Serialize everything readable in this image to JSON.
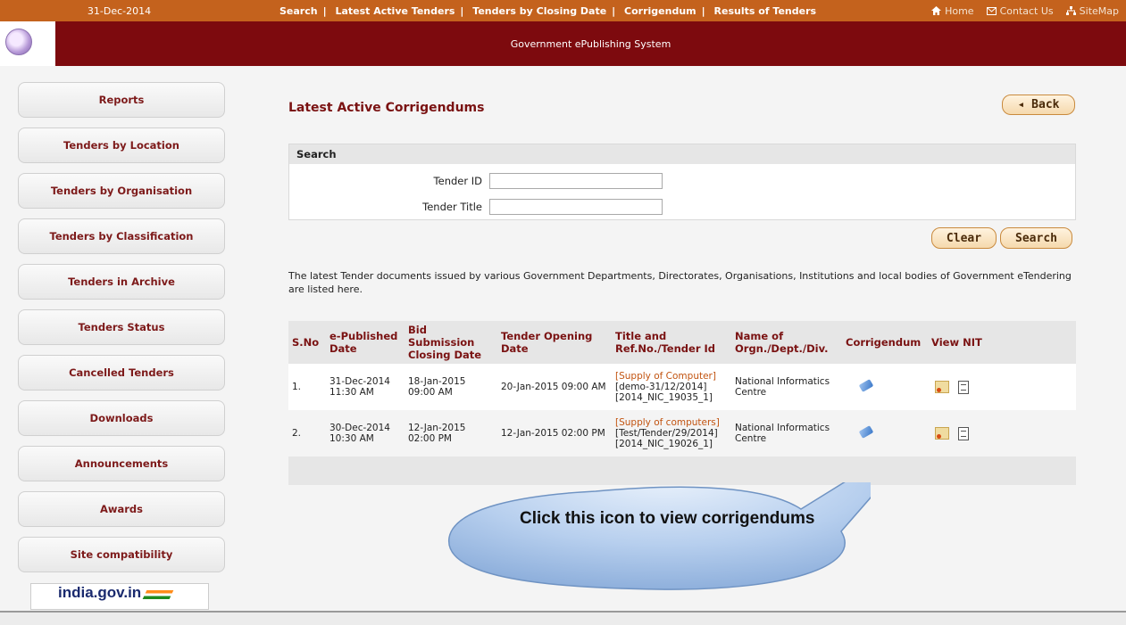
{
  "topbar": {
    "date": "31-Dec-2014",
    "nav": [
      "Search",
      "Latest Active Tenders",
      "Tenders by Closing Date",
      "Corrigendum",
      "Results of Tenders"
    ],
    "separator": "|",
    "right_links": [
      {
        "label": "Home",
        "icon": "home-icon"
      },
      {
        "label": "Contact Us",
        "icon": "mail-icon"
      },
      {
        "label": "SiteMap",
        "icon": "sitemap-icon"
      }
    ]
  },
  "banner": {
    "title": "Government ePublishing System"
  },
  "sidebar": {
    "items": [
      "Reports",
      "Tenders by Location",
      "Tenders by Organisation",
      "Tenders by Classification",
      "Tenders in Archive",
      "Tenders Status",
      "Cancelled Tenders",
      "Downloads",
      "Announcements",
      "Awards",
      "Site compatibility"
    ],
    "india_logo": "india.gov.in"
  },
  "main": {
    "title": "Latest Active Corrigendums",
    "back_label": "◂ Back",
    "search": {
      "header": "Search",
      "tender_id_label": "Tender ID",
      "tender_id_value": "",
      "tender_title_label": "Tender Title",
      "tender_title_value": ""
    },
    "clear_label": "Clear",
    "search_label": "Search",
    "description": "The latest Tender documents issued by various Government Departments, Directorates, Organisations, Institutions and local bodies of Government eTendering are listed here.",
    "table": {
      "headers": [
        "S.No",
        "e-Published Date",
        "Bid Submission Closing Date",
        "Tender Opening Date",
        "Title and Ref.No./Tender Id",
        "Name of Orgn./Dept./Div.",
        "Corrigendum",
        "View NIT"
      ],
      "rows": [
        {
          "sno": "1.",
          "published": "31-Dec-2014 11:30 AM",
          "closing": "18-Jan-2015 09:00 AM",
          "opening": "20-Jan-2015 09:00 AM",
          "title": "[Supply of Computer]",
          "ref": "[demo-31/12/2014]",
          "tid": "[2014_NIC_19035_1]",
          "org": "National Informatics Centre"
        },
        {
          "sno": "2.",
          "published": "30-Dec-2014 10:30 AM",
          "closing": "12-Jan-2015 02:00 PM",
          "opening": "12-Jan-2015 02:00 PM",
          "title": "[Supply of computers]",
          "ref": "[Test/Tender/29/2014]",
          "tid": "[2014_NIC_19026_1]",
          "org": "National Informatics Centre"
        }
      ]
    }
  },
  "callout": {
    "text": "Click this icon to view corrigendums"
  },
  "colors": {
    "topbar": "#c4621d",
    "banner": "#7d0a0e",
    "title": "#7a1212",
    "link": "#c25411"
  }
}
